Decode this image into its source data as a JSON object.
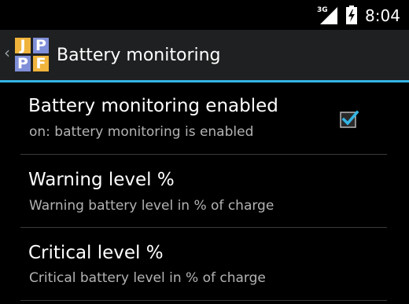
{
  "status_bar": {
    "network": "3G",
    "time": "8:04",
    "icons": [
      "signal-icon",
      "battery-charging-icon"
    ]
  },
  "action_bar": {
    "title": "Battery monitoring",
    "logo_letters": [
      "J",
      "P",
      "P",
      "F"
    ],
    "icons": [
      "up-caret-icon",
      "app-logo-icon"
    ]
  },
  "preferences": [
    {
      "title": "Battery monitoring enabled",
      "summary": "on: battery monitoring is enabled",
      "checked": true
    },
    {
      "title": "Warning level %",
      "summary": "Warning battery level in % of charge"
    },
    {
      "title": "Critical level %",
      "summary": "Critical battery level in % of charge"
    }
  ],
  "colors": {
    "accent": "#33b5e5",
    "logo_orange": "#f0b43c",
    "logo_blue": "#7f8fd8"
  }
}
